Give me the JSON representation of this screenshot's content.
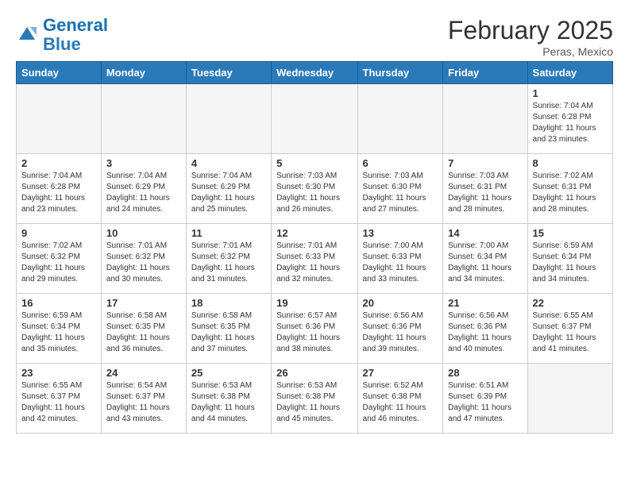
{
  "header": {
    "logo_general": "General",
    "logo_blue": "Blue",
    "month": "February 2025",
    "location": "Peras, Mexico"
  },
  "days_of_week": [
    "Sunday",
    "Monday",
    "Tuesday",
    "Wednesday",
    "Thursday",
    "Friday",
    "Saturday"
  ],
  "weeks": [
    [
      {
        "day": "",
        "info": ""
      },
      {
        "day": "",
        "info": ""
      },
      {
        "day": "",
        "info": ""
      },
      {
        "day": "",
        "info": ""
      },
      {
        "day": "",
        "info": ""
      },
      {
        "day": "",
        "info": ""
      },
      {
        "day": "1",
        "info": "Sunrise: 7:04 AM\nSunset: 6:28 PM\nDaylight: 11 hours\nand 23 minutes."
      }
    ],
    [
      {
        "day": "2",
        "info": "Sunrise: 7:04 AM\nSunset: 6:28 PM\nDaylight: 11 hours\nand 23 minutes."
      },
      {
        "day": "3",
        "info": "Sunrise: 7:04 AM\nSunset: 6:29 PM\nDaylight: 11 hours\nand 24 minutes."
      },
      {
        "day": "4",
        "info": "Sunrise: 7:04 AM\nSunset: 6:29 PM\nDaylight: 11 hours\nand 25 minutes."
      },
      {
        "day": "5",
        "info": "Sunrise: 7:03 AM\nSunset: 6:30 PM\nDaylight: 11 hours\nand 26 minutes."
      },
      {
        "day": "6",
        "info": "Sunrise: 7:03 AM\nSunset: 6:30 PM\nDaylight: 11 hours\nand 27 minutes."
      },
      {
        "day": "7",
        "info": "Sunrise: 7:03 AM\nSunset: 6:31 PM\nDaylight: 11 hours\nand 28 minutes."
      },
      {
        "day": "8",
        "info": "Sunrise: 7:02 AM\nSunset: 6:31 PM\nDaylight: 11 hours\nand 28 minutes."
      }
    ],
    [
      {
        "day": "9",
        "info": "Sunrise: 7:02 AM\nSunset: 6:32 PM\nDaylight: 11 hours\nand 29 minutes."
      },
      {
        "day": "10",
        "info": "Sunrise: 7:01 AM\nSunset: 6:32 PM\nDaylight: 11 hours\nand 30 minutes."
      },
      {
        "day": "11",
        "info": "Sunrise: 7:01 AM\nSunset: 6:32 PM\nDaylight: 11 hours\nand 31 minutes."
      },
      {
        "day": "12",
        "info": "Sunrise: 7:01 AM\nSunset: 6:33 PM\nDaylight: 11 hours\nand 32 minutes."
      },
      {
        "day": "13",
        "info": "Sunrise: 7:00 AM\nSunset: 6:33 PM\nDaylight: 11 hours\nand 33 minutes."
      },
      {
        "day": "14",
        "info": "Sunrise: 7:00 AM\nSunset: 6:34 PM\nDaylight: 11 hours\nand 34 minutes."
      },
      {
        "day": "15",
        "info": "Sunrise: 6:59 AM\nSunset: 6:34 PM\nDaylight: 11 hours\nand 34 minutes."
      }
    ],
    [
      {
        "day": "16",
        "info": "Sunrise: 6:59 AM\nSunset: 6:34 PM\nDaylight: 11 hours\nand 35 minutes."
      },
      {
        "day": "17",
        "info": "Sunrise: 6:58 AM\nSunset: 6:35 PM\nDaylight: 11 hours\nand 36 minutes."
      },
      {
        "day": "18",
        "info": "Sunrise: 6:58 AM\nSunset: 6:35 PM\nDaylight: 11 hours\nand 37 minutes."
      },
      {
        "day": "19",
        "info": "Sunrise: 6:57 AM\nSunset: 6:36 PM\nDaylight: 11 hours\nand 38 minutes."
      },
      {
        "day": "20",
        "info": "Sunrise: 6:56 AM\nSunset: 6:36 PM\nDaylight: 11 hours\nand 39 minutes."
      },
      {
        "day": "21",
        "info": "Sunrise: 6:56 AM\nSunset: 6:36 PM\nDaylight: 11 hours\nand 40 minutes."
      },
      {
        "day": "22",
        "info": "Sunrise: 6:55 AM\nSunset: 6:37 PM\nDaylight: 11 hours\nand 41 minutes."
      }
    ],
    [
      {
        "day": "23",
        "info": "Sunrise: 6:55 AM\nSunset: 6:37 PM\nDaylight: 11 hours\nand 42 minutes."
      },
      {
        "day": "24",
        "info": "Sunrise: 6:54 AM\nSunset: 6:37 PM\nDaylight: 11 hours\nand 43 minutes."
      },
      {
        "day": "25",
        "info": "Sunrise: 6:53 AM\nSunset: 6:38 PM\nDaylight: 11 hours\nand 44 minutes."
      },
      {
        "day": "26",
        "info": "Sunrise: 6:53 AM\nSunset: 6:38 PM\nDaylight: 11 hours\nand 45 minutes."
      },
      {
        "day": "27",
        "info": "Sunrise: 6:52 AM\nSunset: 6:38 PM\nDaylight: 11 hours\nand 46 minutes."
      },
      {
        "day": "28",
        "info": "Sunrise: 6:51 AM\nSunset: 6:39 PM\nDaylight: 11 hours\nand 47 minutes."
      },
      {
        "day": "",
        "info": ""
      }
    ]
  ]
}
